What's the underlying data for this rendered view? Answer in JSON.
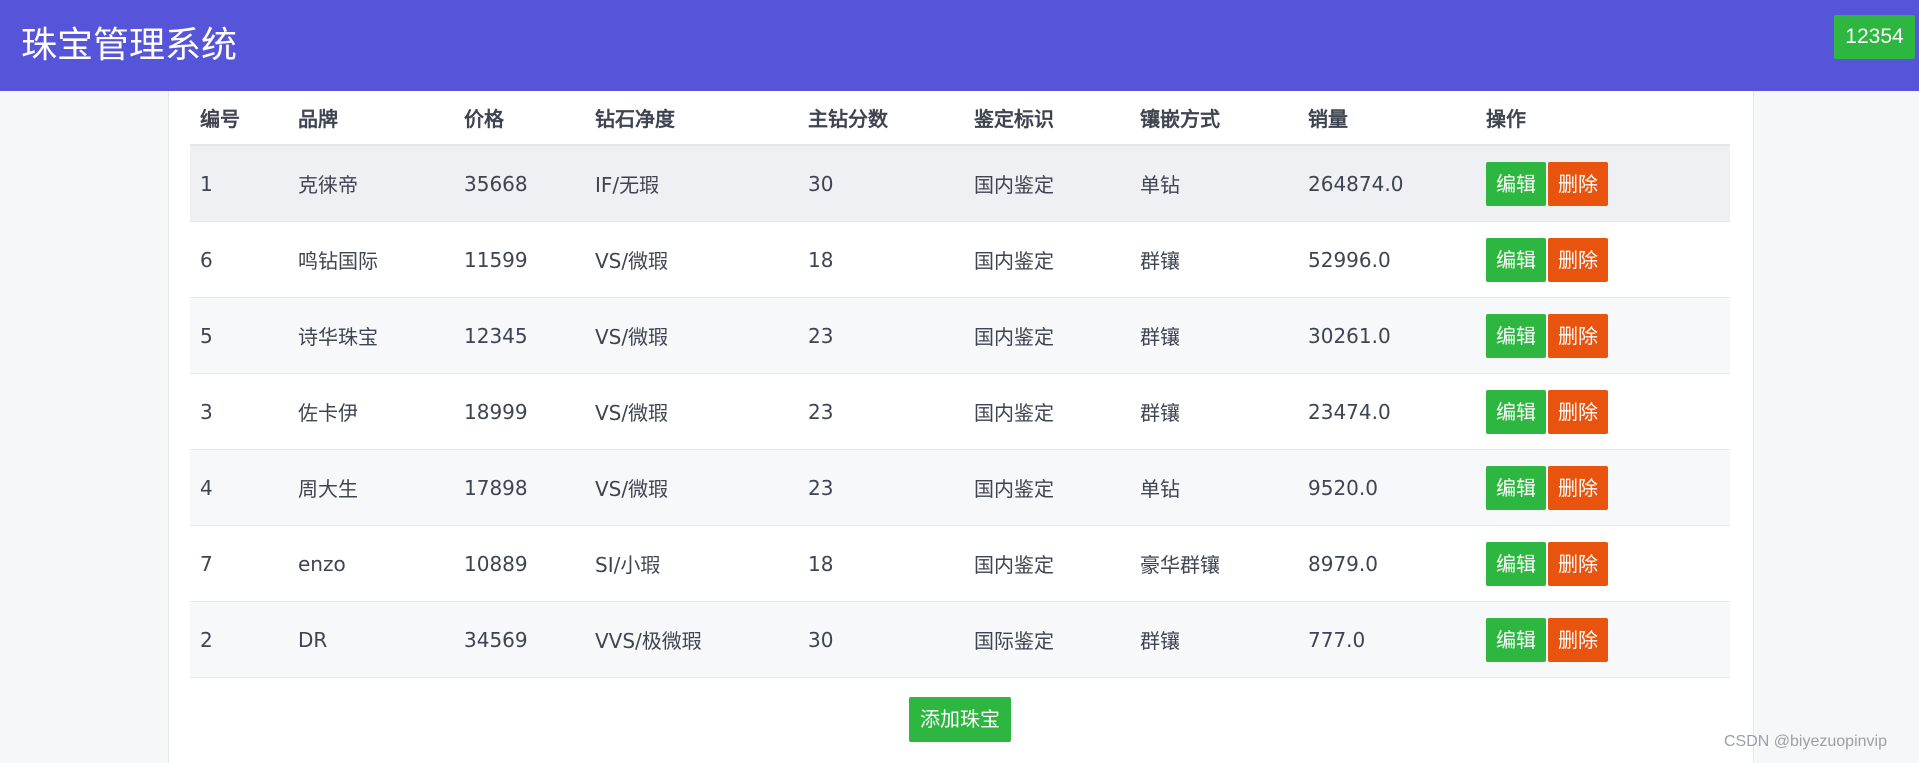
{
  "header": {
    "title": "珠宝管理系统",
    "user": "12354"
  },
  "table": {
    "columns": [
      "编号",
      "品牌",
      "价格",
      "钻石净度",
      "主钻分数",
      "鉴定标识",
      "镶嵌方式",
      "销量",
      "操作"
    ],
    "rows": [
      [
        "1",
        "克徕帝",
        "35668",
        "IF/无瑕",
        "30",
        "国内鉴定",
        "单钻",
        "264874.0"
      ],
      [
        "6",
        "鸣钻国际",
        "11599",
        "VS/微瑕",
        "18",
        "国内鉴定",
        "群镶",
        "52996.0"
      ],
      [
        "5",
        "诗华珠宝",
        "12345",
        "VS/微瑕",
        "23",
        "国内鉴定",
        "群镶",
        "30261.0"
      ],
      [
        "3",
        "佐卡伊",
        "18999",
        "VS/微瑕",
        "23",
        "国内鉴定",
        "群镶",
        "23474.0"
      ],
      [
        "4",
        "周大生",
        "17898",
        "VS/微瑕",
        "23",
        "国内鉴定",
        "单钻",
        "9520.0"
      ],
      [
        "7",
        "enzo",
        "10889",
        "SI/小瑕",
        "18",
        "国内鉴定",
        "豪华群镶",
        "8979.0"
      ],
      [
        "2",
        "DR",
        "34569",
        "VVS/极微瑕",
        "30",
        "国际鉴定",
        "群镶",
        "777.0"
      ]
    ],
    "edit_label": "编辑",
    "delete_label": "删除"
  },
  "add_button": "添加珠宝",
  "watermark": "CSDN @biyezuopinvip",
  "colors": {
    "header": "#5654d8",
    "edit": "#2db640",
    "delete": "#e8530e"
  }
}
